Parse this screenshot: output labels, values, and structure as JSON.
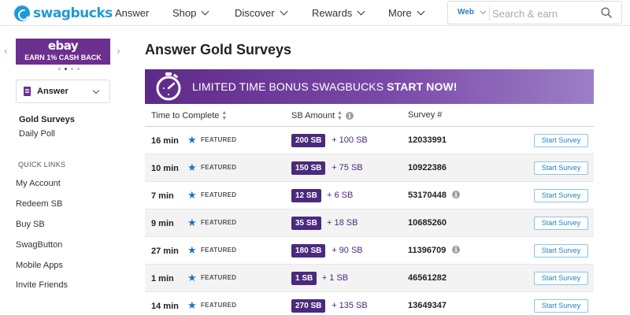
{
  "header": {
    "logo_text": "swagbucks",
    "nav": [
      {
        "label": "Answer",
        "has_menu": false
      },
      {
        "label": "Shop",
        "has_menu": true
      },
      {
        "label": "Discover",
        "has_menu": true
      },
      {
        "label": "Rewards",
        "has_menu": true
      },
      {
        "label": "More",
        "has_menu": true
      }
    ],
    "search": {
      "scope": "Web",
      "placeholder": "Search & earn",
      "icon": "magnifier-icon"
    }
  },
  "sidebar": {
    "ad": {
      "brand": "ebay",
      "tagline": "EARN 1% CASH BACK",
      "dot_count": 4,
      "active_dot": 1
    },
    "dropdown": {
      "label": "Answer",
      "icon": "clipboard-icon"
    },
    "sub_nav": [
      {
        "label": "Gold Surveys",
        "active": true
      },
      {
        "label": "Daily Poll",
        "active": false
      }
    ],
    "quick_links_title": "QUICK LINKS",
    "quick_links": [
      "My Account",
      "Redeem SB",
      "Buy SB",
      "SwagButton",
      "Mobile Apps",
      "Invite Friends"
    ]
  },
  "main": {
    "title": "Answer Gold Surveys",
    "banner": {
      "text_plain": "LIMITED TIME BONUS SWAGBUCKS ",
      "text_bold": "START NOW!",
      "icon": "stopwatch-icon"
    },
    "columns": {
      "time": "Time to Complete",
      "amount": "SB Amount",
      "survey": "Survey #"
    },
    "featured_label": "FEATURED",
    "start_label": "Start Survey",
    "rows": [
      {
        "time": "16 min",
        "sb": "200 SB",
        "bonus": "+ 100 SB",
        "survey": "12033991",
        "info": false
      },
      {
        "time": "10 min",
        "sb": "150 SB",
        "bonus": "+ 75 SB",
        "survey": "10922386",
        "info": false
      },
      {
        "time": "7 min",
        "sb": "12 SB",
        "bonus": "+ 6 SB",
        "survey": "53170448",
        "info": true
      },
      {
        "time": "9 min",
        "sb": "35 SB",
        "bonus": "+ 18 SB",
        "survey": "10685260",
        "info": false
      },
      {
        "time": "27 min",
        "sb": "180 SB",
        "bonus": "+ 90 SB",
        "survey": "11396709",
        "info": true
      },
      {
        "time": "1 min",
        "sb": "1 SB",
        "bonus": "+ 1 SB",
        "survey": "46561282",
        "info": false
      },
      {
        "time": "14 min",
        "sb": "270 SB",
        "bonus": "+ 135 SB",
        "survey": "13649347",
        "info": false
      }
    ]
  },
  "colors": {
    "brand_blue": "#1e9bd7",
    "purple": "#4b2a7e",
    "ad_purple": "#6b2f8e",
    "button_text": "#1e84c4"
  }
}
